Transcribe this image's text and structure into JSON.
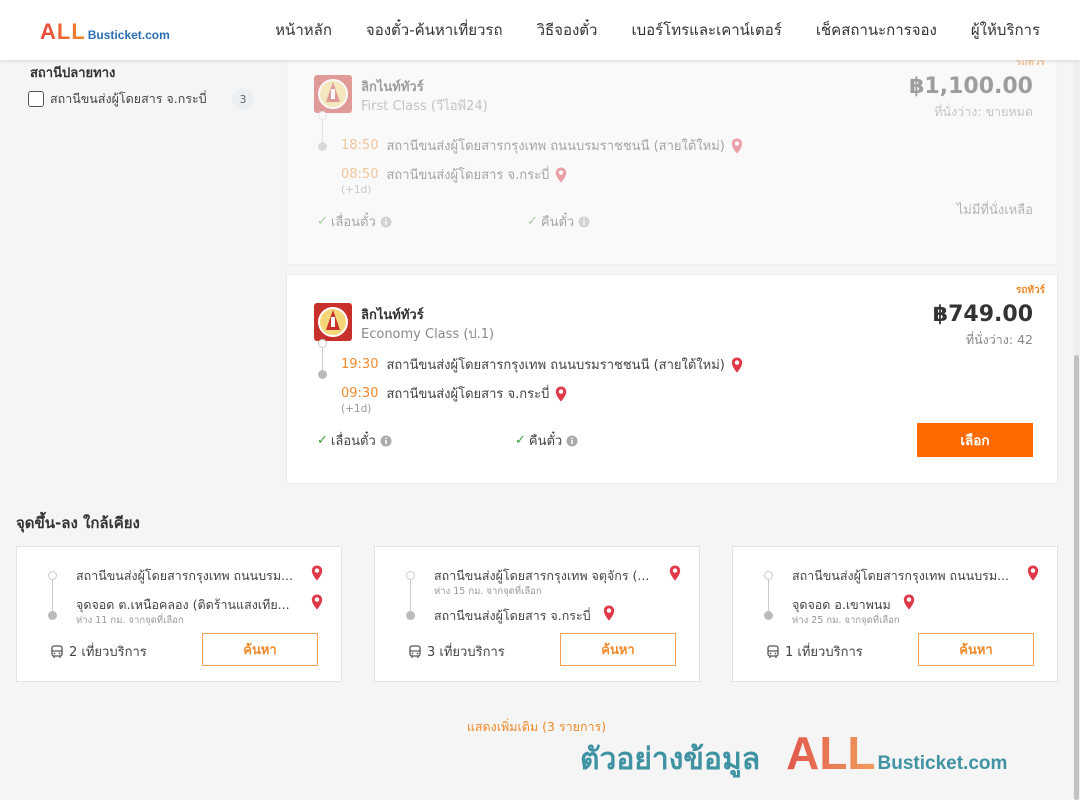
{
  "header": {
    "logo_all": "ALL",
    "logo_busticket": "Busticket.com",
    "nav": [
      "หน้าหลัก",
      "จองตั๋ว-ค้นหาเที่ยวรถ",
      "วิธีจองตั๋ว",
      "เบอร์โทรและเคาน์เตอร์",
      "เช็คสถานะการจอง",
      "ผู้ให้บริการ"
    ]
  },
  "filter": {
    "title": "สถานีปลายทาง",
    "option_label": "สถานีขนส่งผู้โดยสาร จ.กระบี่",
    "option_count": "3"
  },
  "trips": [
    {
      "tag": "รถทัวร์",
      "operator": "ลิกไนท์ทัวร์",
      "bus_class": "First Class (วีไอพี24)",
      "price": "฿1,100.00",
      "seats": "ที่นั่งว่าง: ขายหมด",
      "depart_time": "18:50",
      "depart_station": "สถานีขนส่งผู้โดยสารกรุงเทพ ถนนบรมราชชนนี (สายใต้ใหม่)",
      "arrive_time": "08:50",
      "arrive_station": "สถานีขนส่งผู้โดยสาร จ.กระบี่",
      "next_day": "(+1d)",
      "reschedule_label": "เลื่อนตั๋ว",
      "refund_label": "คืนตั๋ว",
      "status": "ไม่มีที่นั่งเหลือ"
    },
    {
      "tag": "รถทัวร์",
      "operator": "ลิกไนท์ทัวร์",
      "bus_class": "Economy Class (ป.1)",
      "price": "฿749.00",
      "seats": "ที่นั่งว่าง: 42",
      "depart_time": "19:30",
      "depart_station": "สถานีขนส่งผู้โดยสารกรุงเทพ ถนนบรมราชชนนี (สายใต้ใหม่)",
      "arrive_time": "09:30",
      "arrive_station": "สถานีขนส่งผู้โดยสาร จ.กระบี่",
      "next_day": "(+1d)",
      "reschedule_label": "เลื่อนตั๋ว",
      "refund_label": "คืนตั๋ว",
      "select_label": "เลือก"
    }
  ],
  "nearby": {
    "title": "จุดขึ้น-ลง ใกล้เคียง",
    "cards": [
      {
        "from": "สถานีขนส่งผู้โดยสารกรุงเทพ ถนนบรม...",
        "from_distance": "",
        "to": "จุดจอด ต.เหนือคลอง (ติดร้านแสงเทีย...",
        "to_distance": "ห่าง 11 กม. จากจุดที่เลือก",
        "trips": "2 เที่ยวบริการ",
        "button": "ค้นหา"
      },
      {
        "from": "สถานีขนส่งผู้โดยสารกรุงเทพ จตุจักร (...",
        "from_distance": "ห่าง 15 กม. จากจุดที่เลือก",
        "to": "สถานีขนส่งผู้โดยสาร จ.กระบี่",
        "to_distance": "",
        "trips": "3 เที่ยวบริการ",
        "button": "ค้นหา"
      },
      {
        "from": "สถานีขนส่งผู้โดยสารกรุงเทพ ถนนบรม...",
        "from_distance": "",
        "to": "จุดจอด อ.เขาพนม",
        "to_distance": "ห่าง 25 กม. จากจุดที่เลือก",
        "trips": "1 เที่ยวบริการ",
        "button": "ค้นหา"
      }
    ]
  },
  "show_more": "แสดงเพิ่มเติม (3 รายการ)",
  "watermark": {
    "text": "ตัวอย่างข้อมูล",
    "all": "ALL",
    "busticket": "Busticket.com"
  },
  "colors": {
    "accent": "#ff6a00",
    "time": "#f08a2c",
    "check": "#3b9e3b",
    "pin": "#e0394a"
  }
}
